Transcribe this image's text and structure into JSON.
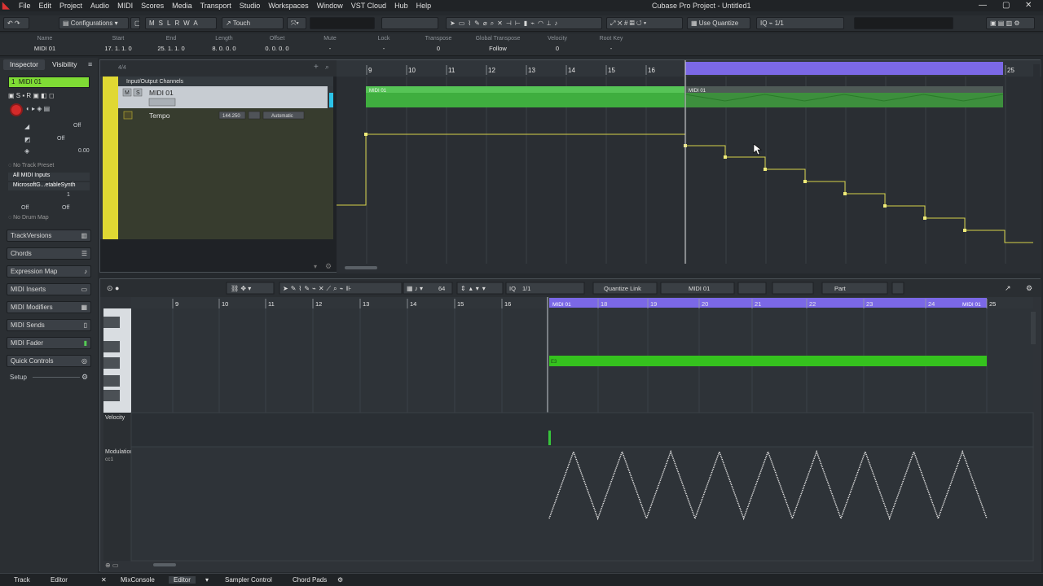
{
  "app": {
    "window_title": "Cubase Pro Project - Untitled1",
    "menu": [
      "File",
      "Edit",
      "Project",
      "Audio",
      "MIDI",
      "Scores",
      "Media",
      "Transport",
      "Studio",
      "Workspaces",
      "Window",
      "VST Cloud",
      "Hub",
      "Help"
    ],
    "window_controls": [
      "—",
      "▢",
      "✕"
    ]
  },
  "toolbar": {
    "configurations": "Configurations",
    "msrwa": [
      "M",
      "S",
      "L",
      "R",
      "W",
      "A"
    ],
    "automation_mode": "Touch",
    "quantize_preset": "Use Quantize",
    "grid_type": "1/1"
  },
  "infoline": {
    "headers": [
      "Name",
      "Start",
      "End",
      "Length",
      "Offset",
      "Mute",
      "Lock",
      "Transpose",
      "Global Transpose",
      "Velocity",
      "Root Key"
    ],
    "values": [
      "MIDI 01",
      "17. 1. 1.   0",
      "25. 1. 1.   0",
      "8. 0. 0.   0",
      "0. 0. 0.   0",
      "-",
      "-",
      "0",
      "Follow",
      "0",
      "-"
    ]
  },
  "inspector": {
    "tabs": [
      "Inspector",
      "Visibility"
    ],
    "track_name": "MIDI 01",
    "track_number": "1",
    "volume_value": "Off",
    "pan_value": "Off",
    "delay_value": "0.00",
    "track_preset": "No Track Preset",
    "input": "All MIDI Inputs",
    "output": "MicrosoftG...etableSynth",
    "channel": "1",
    "bank": "Off",
    "program": "Off",
    "drum_map": "No Drum Map",
    "sections": [
      "TrackVersions",
      "Chords",
      "Expression Map",
      "MIDI Inserts",
      "MIDI Modifiers",
      "MIDI Sends",
      "MIDI Fader",
      "Quick Controls"
    ],
    "setup": "Setup"
  },
  "project": {
    "signature": "4/4",
    "folder": "Input/Output Channels",
    "tracks": [
      {
        "name": "MIDI 01",
        "mute": "M",
        "solo": "S"
      },
      {
        "name": "Tempo",
        "bpm": "144.250",
        "mode": "Automatic"
      }
    ],
    "ruler": [
      "9",
      "10",
      "11",
      "12",
      "13",
      "14",
      "15",
      "16",
      "17",
      "18",
      "19",
      "20",
      "21",
      "22",
      "23",
      "24",
      "25"
    ],
    "parts": [
      "MIDI 01",
      "MIDI 01"
    ],
    "tempo_steps": 8,
    "colors": {
      "selection": "#7b68e6",
      "part": "#3fae3f",
      "tempo_line": "#d6d24a",
      "track_color": "#e0d833"
    }
  },
  "editor": {
    "velocity_value": "64",
    "quantize": "1/1",
    "quantize_link": "Quantize Link",
    "part_name": "MIDI 01",
    "edit_mode": "Part",
    "ruler": [
      "9",
      "10",
      "11",
      "12",
      "13",
      "14",
      "15",
      "16",
      "18",
      "19",
      "20",
      "21",
      "22",
      "23",
      "24",
      "25"
    ],
    "part_start_label": "MIDI 01",
    "part_end_label": "MIDI 01",
    "note_label": "E3",
    "lanes": [
      {
        "name": "Velocity"
      },
      {
        "name": "Modulation",
        "sub": "cc1"
      }
    ],
    "modulation_cycles": 9
  },
  "bottombar": {
    "left_tabs": [
      "Track",
      "Editor"
    ],
    "tabs": [
      "MixConsole",
      "Editor",
      "Sampler Control",
      "Chord Pads"
    ]
  }
}
